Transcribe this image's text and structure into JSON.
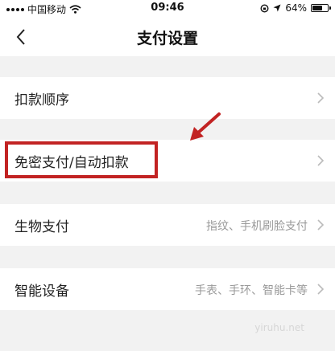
{
  "status_bar": {
    "carrier": "中国移动",
    "time": "09:46",
    "battery": "64%",
    "battery_level": 0.64
  },
  "nav": {
    "title": "支付设置"
  },
  "settings": [
    {
      "label": "扣款顺序",
      "value": ""
    },
    {
      "label": "免密支付/自动扣款",
      "value": ""
    },
    {
      "label": "生物支付",
      "value": "指纹、手机刷脸支付"
    },
    {
      "label": "智能设备",
      "value": "手表、手环、智能卡等"
    }
  ],
  "watermark": "yiruhu.net",
  "colors": {
    "highlight": "#c22323",
    "background": "#f2f2f2",
    "row_background": "#ffffff",
    "secondary_text": "#999999"
  }
}
